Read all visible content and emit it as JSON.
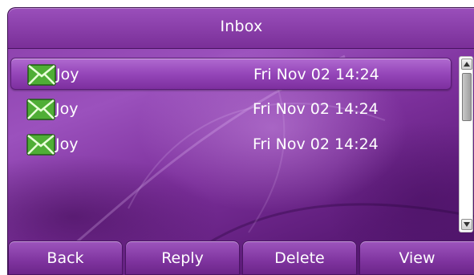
{
  "title": "Inbox",
  "messages": [
    {
      "sender": "Joy",
      "date": "Fri Nov 02 14:24",
      "selected": true
    },
    {
      "sender": "Joy",
      "date": "Fri Nov 02 14:24",
      "selected": false
    },
    {
      "sender": "Joy",
      "date": "Fri Nov 02 14:24",
      "selected": false
    }
  ],
  "softkeys": {
    "back": "Back",
    "reply": "Reply",
    "delete": "Delete",
    "view": "View"
  },
  "icons": {
    "message": "envelope-icon",
    "scroll_up": "arrow-up-icon",
    "scroll_down": "arrow-down-icon"
  },
  "colors": {
    "theme_purple": "#8a3ea9",
    "selection": "#9546b9",
    "envelope_green": "#5dbb3f",
    "text": "#ffffff"
  }
}
